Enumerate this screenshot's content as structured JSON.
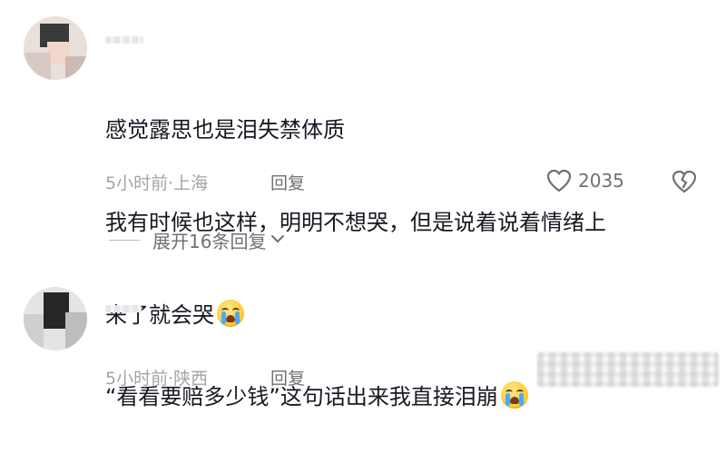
{
  "comments": [
    {
      "lines": [
        "感觉露思也是泪失禁体质",
        "我有时候也这样，明明不想哭，但是说着说着情绪上",
        "来了就会哭"
      ],
      "emoji": "loudly-crying-face",
      "time": "5小时前",
      "separator": "·",
      "location": "上海",
      "reply_label": "回复",
      "likes": "2035",
      "expand_label": "展开16条回复"
    },
    {
      "lines": [
        "“看看要赔多少钱”这句话出来我直接泪崩"
      ],
      "emoji": "loudly-crying-face",
      "time": "5小时前",
      "separator": "·",
      "location": "陕西",
      "reply_label": "回复"
    }
  ],
  "colors": {
    "text": "#161823",
    "meta": "#a3a4a8",
    "action": "#6f7075"
  }
}
